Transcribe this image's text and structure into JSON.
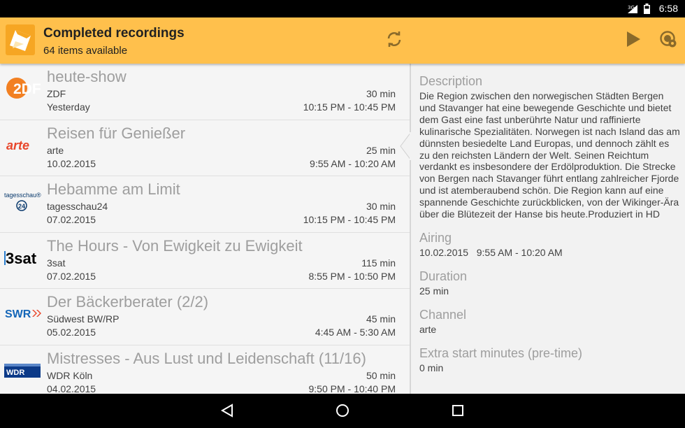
{
  "status_bar": {
    "time": "6:58",
    "network": "3G"
  },
  "action_bar": {
    "title": "Completed recordings",
    "subtitle": "64 items available",
    "accent": "#ffc04c"
  },
  "recordings": [
    {
      "title": "heute-show",
      "channel": "ZDF",
      "date": "Yesterday",
      "duration": "30 min",
      "time": "10:15 PM - 10:45 PM",
      "logo_text": "2DF",
      "logo_color": "#f28022"
    },
    {
      "title": "Reisen für Genießer",
      "channel": "arte",
      "date": "10.02.2015",
      "duration": "25 min",
      "time": "9:55 AM - 10:20 AM",
      "logo_text": "arte",
      "logo_color": "#e8462b"
    },
    {
      "title": "Hebamme am Limit",
      "channel": "tagesschau24",
      "date": "07.02.2015",
      "duration": "30 min",
      "time": "10:15 PM - 10:45 PM",
      "logo_text": "tagesschau®",
      "logo_sub": "24",
      "logo_color": "#0a3a6d"
    },
    {
      "title": "The Hours - Von Ewigkeit zu Ewigkeit",
      "channel": "3sat",
      "date": "07.02.2015",
      "duration": "115 min",
      "time": "8:55 PM - 10:50 PM",
      "logo_text": "3sat",
      "logo_color": "#000000"
    },
    {
      "title": "Der Bäckerberater (2/2)",
      "channel": "Südwest BW/RP",
      "date": "05.02.2015",
      "duration": "45 min",
      "time": "4:45 AM - 5:30 AM",
      "logo_text": "SWR",
      "logo_color": "#1466b8"
    },
    {
      "title": "Mistresses - Aus Lust und Leidenschaft (11/16)",
      "channel": "WDR Köln",
      "date": "04.02.2015",
      "duration": "50 min",
      "time": "9:50 PM - 10:40 PM",
      "logo_text": "WDR",
      "logo_color": "#0c3a88"
    }
  ],
  "detail": {
    "description_label": "Description",
    "description": "Die Region zwischen den norwegischen Städten Bergen und Stavanger hat eine bewegende Geschichte und bietet dem Gast eine fast unberührte Natur und raffinierte kulinarische Spezialitäten. Norwegen ist nach Island das am dünnsten besiedelte Land Europas, und dennoch zählt es zu den reichsten Ländern der Welt. Seinen Reichtum verdankt es insbesondere der Erdölproduktion. Die Strecke von Bergen nach Stavanger führt entlang zahlreicher Fjorde und ist atemberaubend schön. Die Region kann auf eine spannende Geschichte zurückblicken, von der Wikinger-Ära über die Blütezeit der Hanse bis heute.Produziert in HD",
    "airing_label": "Airing",
    "airing": "10.02.2015   9:55 AM - 10:20 AM",
    "duration_label": "Duration",
    "duration": "25 min",
    "channel_label": "Channel",
    "channel": "arte",
    "pretime_label": "Extra start minutes (pre-time)",
    "pretime": "0 min"
  },
  "icons": [
    "app-icon",
    "refresh-icon",
    "play-icon",
    "record-settings-icon",
    "back-icon",
    "home-icon",
    "recents-icon"
  ]
}
